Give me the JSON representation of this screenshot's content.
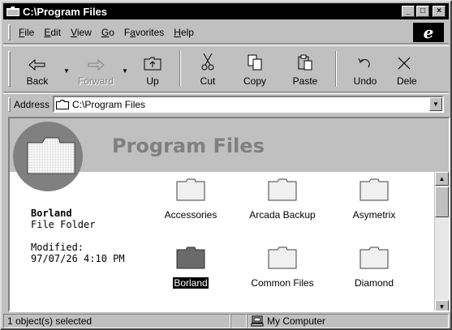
{
  "window": {
    "title": "C:\\Program Files",
    "min": "_",
    "max": "□",
    "close": "×"
  },
  "menu": [
    "File",
    "Edit",
    "View",
    "Go",
    "Favorites",
    "Help"
  ],
  "menu_underline": [
    "F",
    "E",
    "V",
    "G",
    "a",
    "H"
  ],
  "toolbar": {
    "back": "Back",
    "forward": "Forward",
    "up": "Up",
    "cut": "Cut",
    "copy": "Copy",
    "paste": "Paste",
    "undo": "Undo",
    "delete": "Dele"
  },
  "address": {
    "label": "Address",
    "value": "C:\\Program Files"
  },
  "banner": {
    "title": "Program Files"
  },
  "selection": {
    "name": "Borland",
    "type": "File Folder",
    "modified_label": "Modified:",
    "modified_value": "97/07/26 4:10 PM"
  },
  "files": [
    {
      "name": "Accessories",
      "selected": false
    },
    {
      "name": "Arcada Backup",
      "selected": false
    },
    {
      "name": "Asymetrix",
      "selected": false
    },
    {
      "name": "Borland",
      "selected": true
    },
    {
      "name": "Common Files",
      "selected": false
    },
    {
      "name": "Diamond",
      "selected": false
    }
  ],
  "status": {
    "selected": "1 object(s) selected",
    "location": "My Computer"
  },
  "icons": {
    "title": "folder-icon",
    "ie": "ie-logo"
  }
}
